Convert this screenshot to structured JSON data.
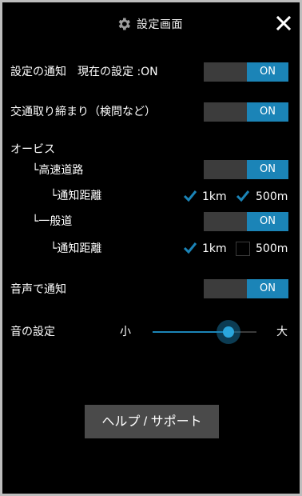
{
  "header": {
    "title": "設定画面",
    "settings_icon": "gear-icon",
    "close_icon": "close-icon"
  },
  "rows": {
    "notify_setting": {
      "label": "設定の通知　現在の設定 :ON",
      "toggle": "ON"
    },
    "traffic_enforcement": {
      "label": "交通取り締まり（検問など）",
      "toggle": "ON"
    },
    "orbis": {
      "label": "オービス"
    },
    "highway": {
      "label": "└高速道路",
      "toggle": "ON"
    },
    "highway_distance": {
      "label": "└通知距離",
      "option_1km": {
        "label": "1km",
        "checked": true
      },
      "option_500m": {
        "label": "500m",
        "checked": true
      }
    },
    "general_road": {
      "label": "└一般道",
      "toggle": "ON"
    },
    "general_distance": {
      "label": "└通知距離",
      "option_1km": {
        "label": "1km",
        "checked": true
      },
      "option_500m": {
        "label": "500m",
        "checked": false
      }
    },
    "voice_notify": {
      "label": "音声で通知",
      "toggle": "ON"
    },
    "sound": {
      "label": "音の設定",
      "min_label": "小",
      "max_label": "大",
      "level": 0.73
    }
  },
  "help_button": "ヘルプ / サポート",
  "colors": {
    "accent": "#1b84b7",
    "toggle_off_bg": "#3c3c3c",
    "background": "#000000",
    "button_bg": "#4a4a4a"
  }
}
